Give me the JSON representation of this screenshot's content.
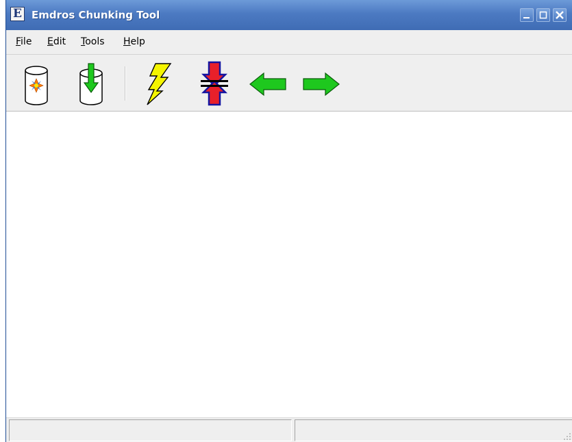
{
  "window": {
    "title": "Emdros Chunking Tool",
    "app_icon_letter": "E",
    "controls": [
      "minimize",
      "maximize",
      "close"
    ]
  },
  "menubar": {
    "items": [
      {
        "id": "file",
        "mnemonic": "F",
        "rest": "ile"
      },
      {
        "id": "edit",
        "mnemonic": "E",
        "rest": "dit"
      },
      {
        "id": "tools",
        "mnemonic": "T",
        "rest": "ools"
      },
      {
        "id": "help",
        "mnemonic": "H",
        "rest": "elp"
      }
    ]
  },
  "toolbar": {
    "buttons": [
      {
        "id": "new-database",
        "icon": "database-star-icon"
      },
      {
        "id": "load-database",
        "icon": "database-download-icon"
      },
      {
        "id": "run",
        "icon": "lightning-icon"
      },
      {
        "id": "compress",
        "icon": "compress-arrows-icon"
      },
      {
        "id": "previous",
        "icon": "arrow-left-icon"
      },
      {
        "id": "next",
        "icon": "arrow-right-icon"
      }
    ]
  },
  "colors": {
    "titlebar": "#4c7ac2",
    "arrow_green": "#1ec81e",
    "lightning_yellow": "#f5f500",
    "compress_red": "#e8202a",
    "compress_blue": "#1414a0"
  },
  "statusbar": {
    "pane1_text": "",
    "pane2_text": ""
  }
}
